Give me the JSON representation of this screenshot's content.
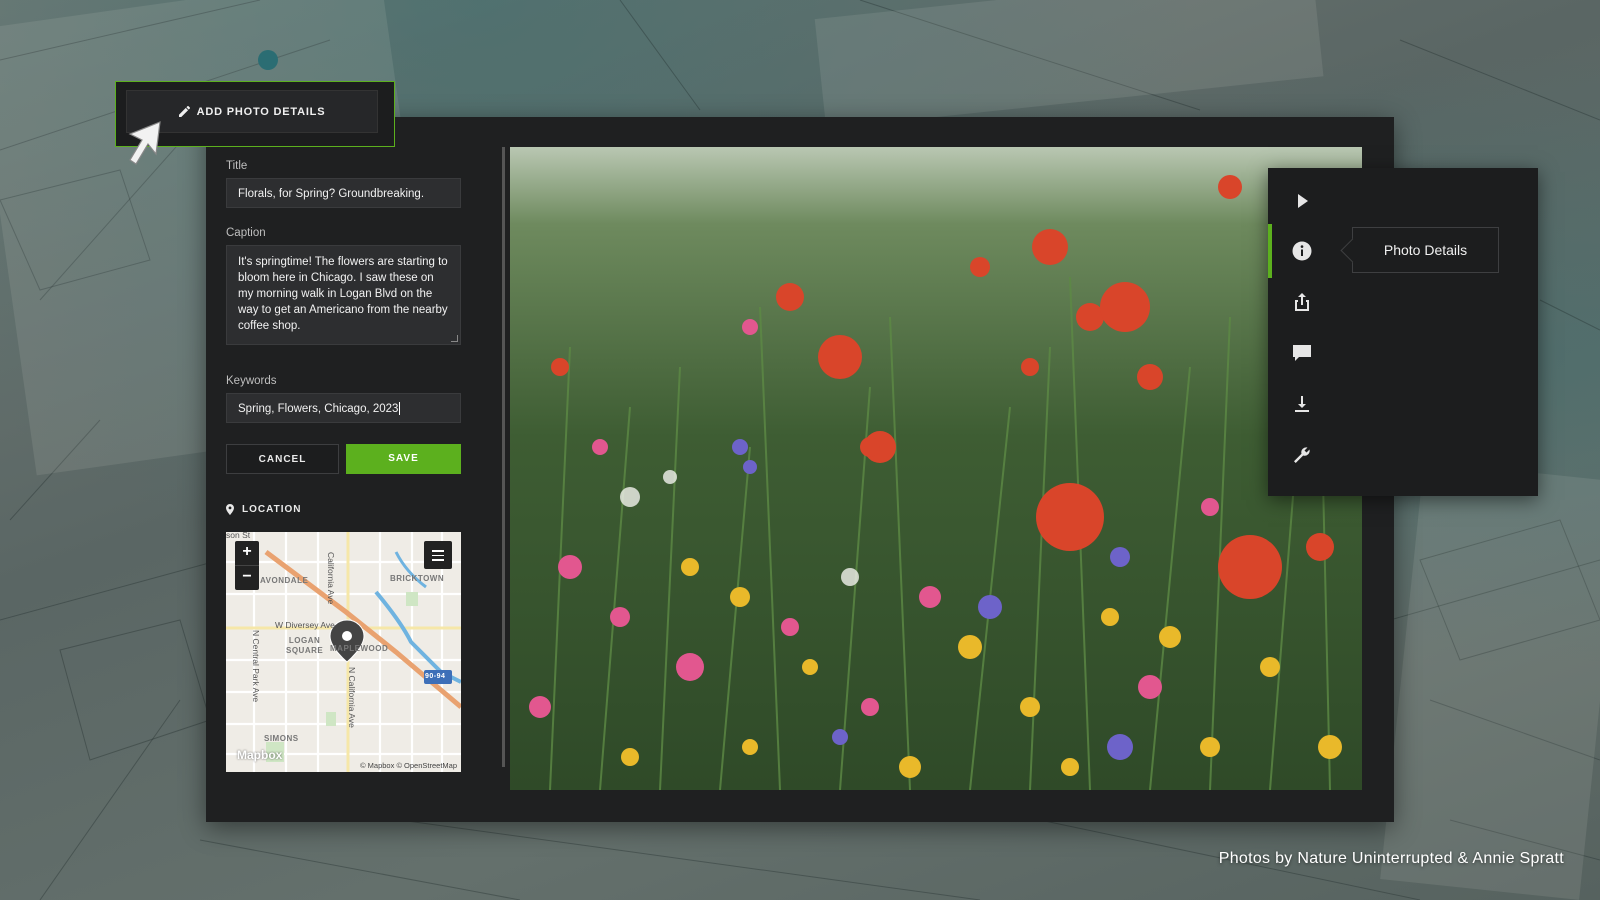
{
  "add_details": {
    "label": "ADD PHOTO DETAILS",
    "icon": "pencil-icon"
  },
  "form": {
    "title_label": "Title",
    "title_value": "Florals, for Spring? Groundbreaking.",
    "caption_label": "Caption",
    "caption_value": "It's springtime! The flowers are starting to bloom here in Chicago. I saw these on my morning walk in Logan Blvd on the way to get an Americano from the nearby coffee shop.",
    "keywords_label": "Keywords",
    "keywords_value": "Spring, Flowers, Chicago, 2023",
    "cancel_label": "CANCEL",
    "save_label": "SAVE",
    "location_label": "LOCATION"
  },
  "map": {
    "zoom_in": "+",
    "zoom_out": "−",
    "labels": {
      "avondale": "AVONDALE",
      "bricktown": "BRICKTOWN",
      "diversey": "W Diversey Ave",
      "logan_square": "LOGAN\nSQUARE",
      "maplewood": "MAPLEWOOD",
      "central_park": "N Central Park Ave",
      "california": "N California Ave",
      "california_top": "California Ave",
      "simons": "SIMONS",
      "interstate": "90-94",
      "top_left": "son St"
    },
    "logo": "Mapbox",
    "attribution": "© Mapbox © OpenStreetMap"
  },
  "rail": {
    "items": [
      "play-icon",
      "info-icon",
      "share-icon",
      "comment-icon",
      "download-icon",
      "wrench-icon"
    ],
    "active": "info-icon",
    "tooltip": "Photo Details"
  },
  "credit": "Photos by Nature Uninterrupted & Annie Spratt",
  "colors": {
    "accent": "#5cb01e",
    "panel": "#1f2021"
  }
}
